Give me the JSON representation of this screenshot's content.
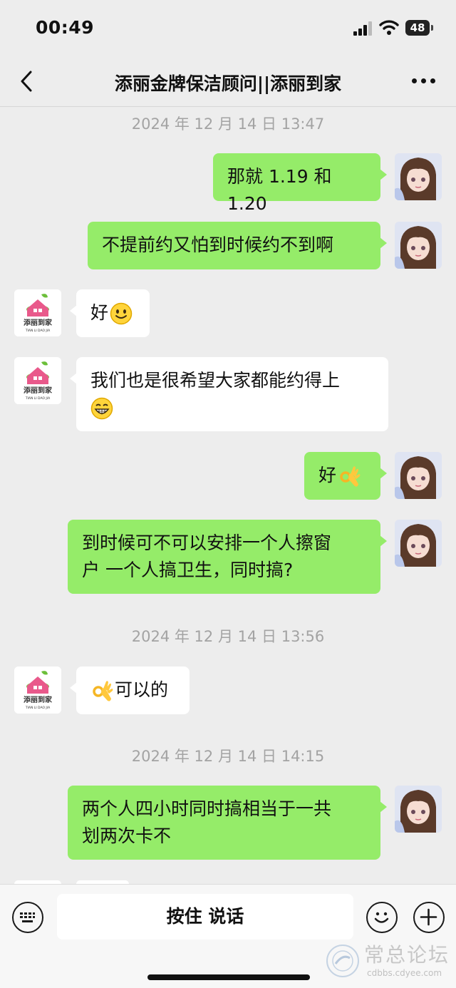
{
  "status_bar": {
    "time": "00:49",
    "battery": "48"
  },
  "header": {
    "title": "添丽金牌保洁顾问||添丽到家"
  },
  "brand_logo": {
    "name": "添丽到家",
    "subtitle": "TIAN LI DAO JIA",
    "color": "#e9598b",
    "leaf_color": "#6cbf3a"
  },
  "colors": {
    "outgoing_bubble": "#95ec69",
    "incoming_bubble": "#ffffff",
    "background": "#ededed"
  },
  "messages": [
    {
      "type": "timestamp",
      "text": "2024 年 12 月 14 日 13:47"
    },
    {
      "type": "out",
      "text": "那就 1.19 和 1.20"
    },
    {
      "type": "out",
      "text": "不提前约又怕到时候约不到啊"
    },
    {
      "type": "in",
      "text": "好",
      "emoji": "smile"
    },
    {
      "type": "in",
      "text": "我们也是很希望大家都能约得上",
      "emoji": "grin"
    },
    {
      "type": "out",
      "text": "好",
      "emoji": "ok-hand"
    },
    {
      "type": "out",
      "text_lines": [
        "到时候可不可以安排一个人擦窗",
        "户 一个人搞卫生，同时搞?"
      ]
    },
    {
      "type": "timestamp",
      "text": "2024 年 12 月 14 日 13:56"
    },
    {
      "type": "in",
      "text": "可以的",
      "emoji": "ok-hand"
    },
    {
      "type": "timestamp",
      "text": "2024 年 12 月 14 日 14:15"
    },
    {
      "type": "out",
      "text_lines": [
        "两个人四小时同时搞相当于一共",
        "划两次卡不"
      ]
    }
  ],
  "input_bar": {
    "voice_icon": "keyboard-icon",
    "hold_to_talk": "按住 说话",
    "emoji_icon": "emoji-icon",
    "plus_icon": "plus-icon"
  },
  "watermark": {
    "text": "常总论坛",
    "url": "cdbbs.cdyee.com"
  }
}
